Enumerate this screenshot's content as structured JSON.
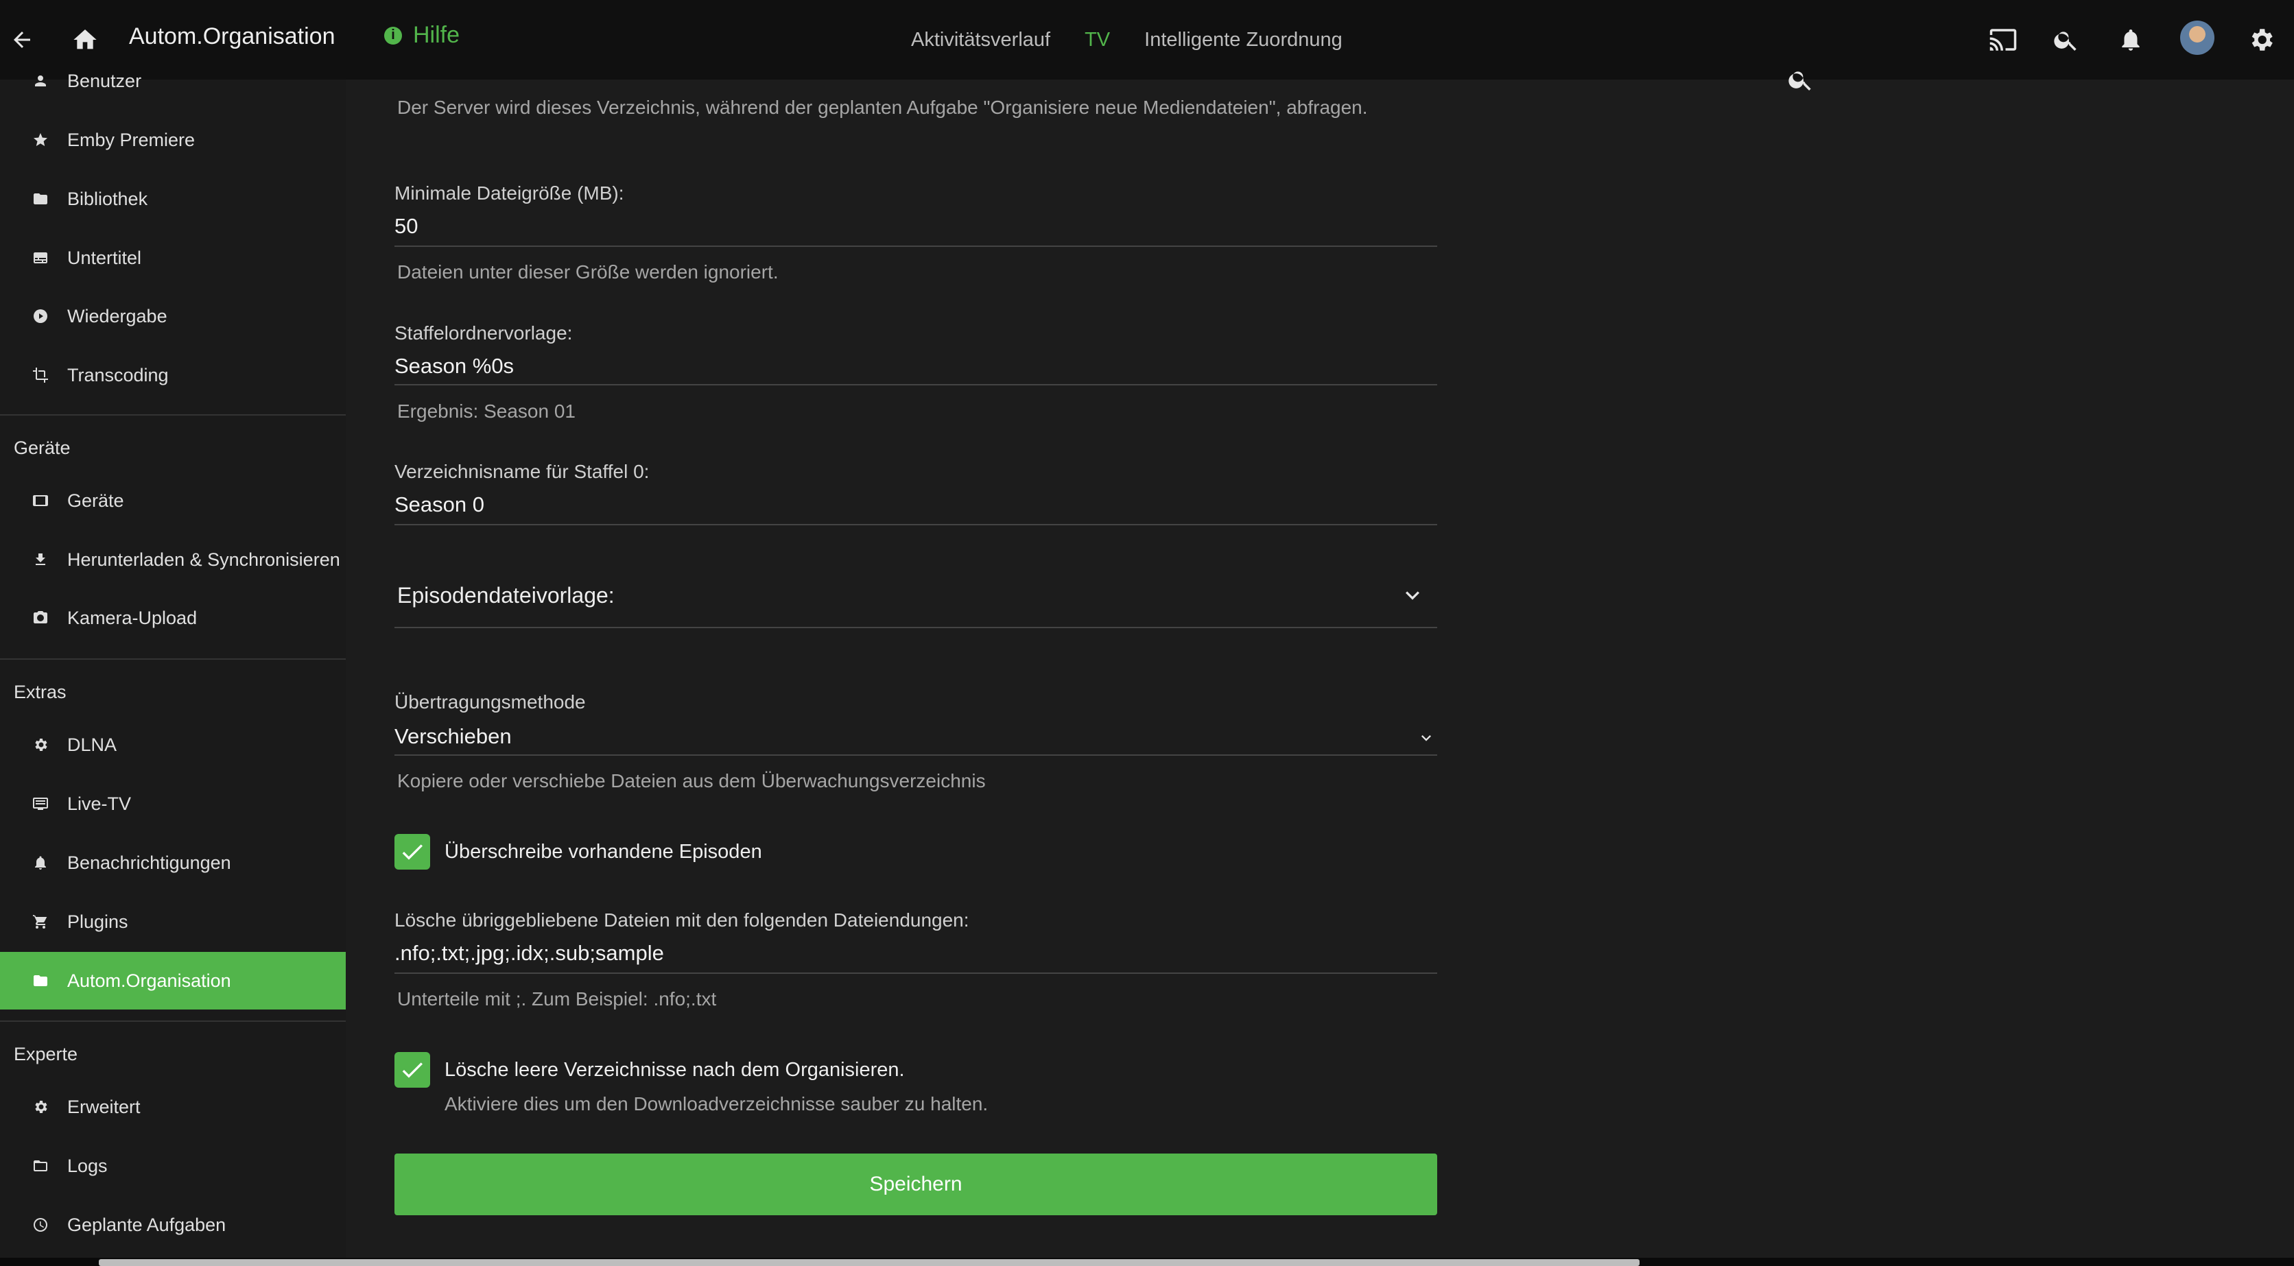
{
  "header": {
    "title": "Autom.Organisation",
    "help_label": "Hilfe",
    "tabs": [
      {
        "label": "Aktivitätsverlauf",
        "active": false
      },
      {
        "label": "TV",
        "active": true
      },
      {
        "label": "Intelligente Zuordnung",
        "active": false
      }
    ],
    "icons": [
      "back-arrow-icon",
      "home-icon",
      "cast-icon",
      "search-icon",
      "bell-icon",
      "gear-icon"
    ]
  },
  "colors": {
    "accent": "#52b54b",
    "background": "#1c1c1c",
    "topbar": "#101010"
  },
  "sidebar": {
    "items_top": [
      {
        "label": "Benutzer",
        "icon": "user-icon"
      },
      {
        "label": "Emby Premiere",
        "icon": "star-icon"
      },
      {
        "label": "Bibliothek",
        "icon": "folder-icon"
      },
      {
        "label": "Untertitel",
        "icon": "subtitles-icon"
      },
      {
        "label": "Wiedergabe",
        "icon": "play-icon"
      },
      {
        "label": "Transcoding",
        "icon": "crop-icon"
      }
    ],
    "sections": [
      {
        "heading": "Geräte",
        "items": [
          {
            "label": "Geräte",
            "icon": "tablet-icon"
          },
          {
            "label": "Herunterladen & Synchronisieren",
            "icon": "download-icon"
          },
          {
            "label": "Kamera-Upload",
            "icon": "camera-icon"
          }
        ]
      },
      {
        "heading": "Extras",
        "items": [
          {
            "label": "DLNA",
            "icon": "settings-icon"
          },
          {
            "label": "Live-TV",
            "icon": "tv-icon"
          },
          {
            "label": "Benachrichtigungen",
            "icon": "bell-icon"
          },
          {
            "label": "Plugins",
            "icon": "cart-icon"
          },
          {
            "label": "Autom.Organisation",
            "icon": "folder-icon",
            "active": true
          }
        ]
      },
      {
        "heading": "Experte",
        "items": [
          {
            "label": "Erweitert",
            "icon": "settings-icon"
          },
          {
            "label": "Logs",
            "icon": "folder-open-icon"
          },
          {
            "label": "Geplante Aufgaben",
            "icon": "clock-icon"
          }
        ]
      }
    ]
  },
  "form": {
    "watch_folder_desc": "Der Server wird dieses Verzeichnis, während der geplanten Aufgabe \"Organisiere neue Mediendateien\", abfragen.",
    "min_size": {
      "label": "Minimale Dateigröße (MB):",
      "value": "50",
      "help": "Dateien unter dieser Größe werden ignoriert."
    },
    "season_pattern": {
      "label": "Staffelordnervorlage:",
      "value": "Season %0s",
      "help": "Ergebnis: Season 01"
    },
    "season_zero": {
      "label": "Verzeichnisname für Staffel 0:",
      "value": "Season 0"
    },
    "episode_pattern": {
      "label": "Episodendateivorlage:"
    },
    "transfer": {
      "label": "Übertragungsmethode",
      "value": "Verschieben",
      "help": "Kopiere oder verschiebe Dateien aus dem Überwachungsverzeichnis"
    },
    "overwrite": {
      "label": "Überschreibe vorhandene Episoden",
      "checked": true
    },
    "delete_ext": {
      "label": "Lösche übriggebliebene Dateien mit den folgenden Dateiendungen:",
      "value": ".nfo;.txt;.jpg;.idx;.sub;sample",
      "help": "Unterteile mit ;. Zum Beispiel: .nfo;.txt"
    },
    "delete_empty": {
      "label": "Lösche leere Verzeichnisse nach dem Organisieren.",
      "desc": "Aktiviere dies um den Downloadverzeichnisse sauber zu halten.",
      "checked": true
    },
    "save_label": "Speichern"
  }
}
